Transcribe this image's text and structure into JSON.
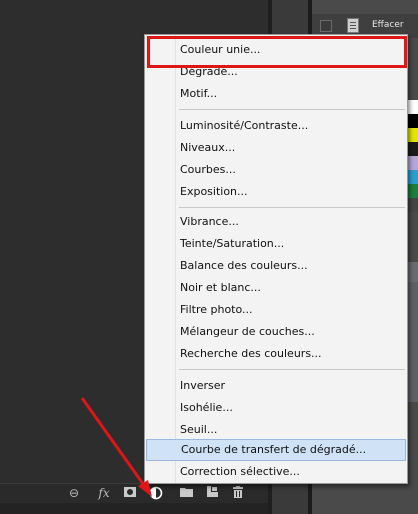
{
  "right_panel": {
    "effacer_label": "Effacer"
  },
  "menu": {
    "items": [
      {
        "label": "Couleur unie..."
      },
      {
        "label": "Dégradé..."
      },
      {
        "label": "Motif..."
      },
      {
        "label": "Luminosité/Contraste..."
      },
      {
        "label": "Niveaux..."
      },
      {
        "label": "Courbes..."
      },
      {
        "label": "Exposition..."
      },
      {
        "label": "Vibrance..."
      },
      {
        "label": "Teinte/Saturation..."
      },
      {
        "label": "Balance des couleurs..."
      },
      {
        "label": "Noir et blanc..."
      },
      {
        "label": "Filtre photo..."
      },
      {
        "label": "Mélangeur de couches..."
      },
      {
        "label": "Recherche des couleurs..."
      },
      {
        "label": "Inverser"
      },
      {
        "label": "Isohélie..."
      },
      {
        "label": "Seuil..."
      },
      {
        "label": "Courbe de transfert de dégradé..."
      },
      {
        "label": "Correction sélective..."
      }
    ],
    "highlighted_item": "Courbe de transfert de dégradé..."
  },
  "bottom_toolbar": {
    "icons": [
      "link-icon",
      "fx-icon",
      "mask-icon",
      "adjustment-icon",
      "folder-icon",
      "new-layer-icon",
      "trash-icon"
    ],
    "fx_label": "fx"
  },
  "colors": {
    "highlight": "#cfe2f6",
    "annotation_red": "#e01515"
  }
}
